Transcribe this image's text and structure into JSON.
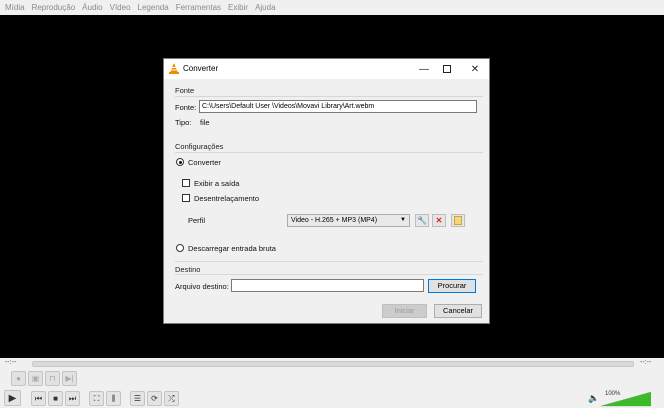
{
  "menu": [
    "Mídia",
    "Reprodução",
    "Áudio",
    "Vídeo",
    "Legenda",
    "Ferramentas",
    "Exibir",
    "Ajuda"
  ],
  "player": {
    "time_elapsed": "--:--",
    "time_total": "--:--",
    "volume": "100%",
    "volume_level": 1.0
  },
  "dialog": {
    "title": "Converter",
    "source_section": "Fonte",
    "source_label": "Fonte:",
    "source_value": "C:\\Users\\Default User \\Videos\\Movavi Library\\Art.webm",
    "type_label": "Tipo:",
    "type_value": "file",
    "settings_section": "Configurações",
    "convert_radio": "Converter",
    "convert_selected": true,
    "show_output_label": "Exibir a saída",
    "deinterlace_label": "Desentrelaçamento",
    "profile_label": "Perfil",
    "profile_value": "Video - H.265 + MP3 (MP4)",
    "dump_raw_label": "Descarregar entrada bruta",
    "destination_section": "Destino",
    "dest_file_label": "Arquivo destino:",
    "dest_file_value": "",
    "browse_label": "Procurar",
    "start_label": "Iniciar",
    "cancel_label": "Cancelar"
  },
  "colors": {
    "vlc_orange": "#f08a00",
    "volume_green": "#3cba2a",
    "delete_red": "#e0201c"
  }
}
